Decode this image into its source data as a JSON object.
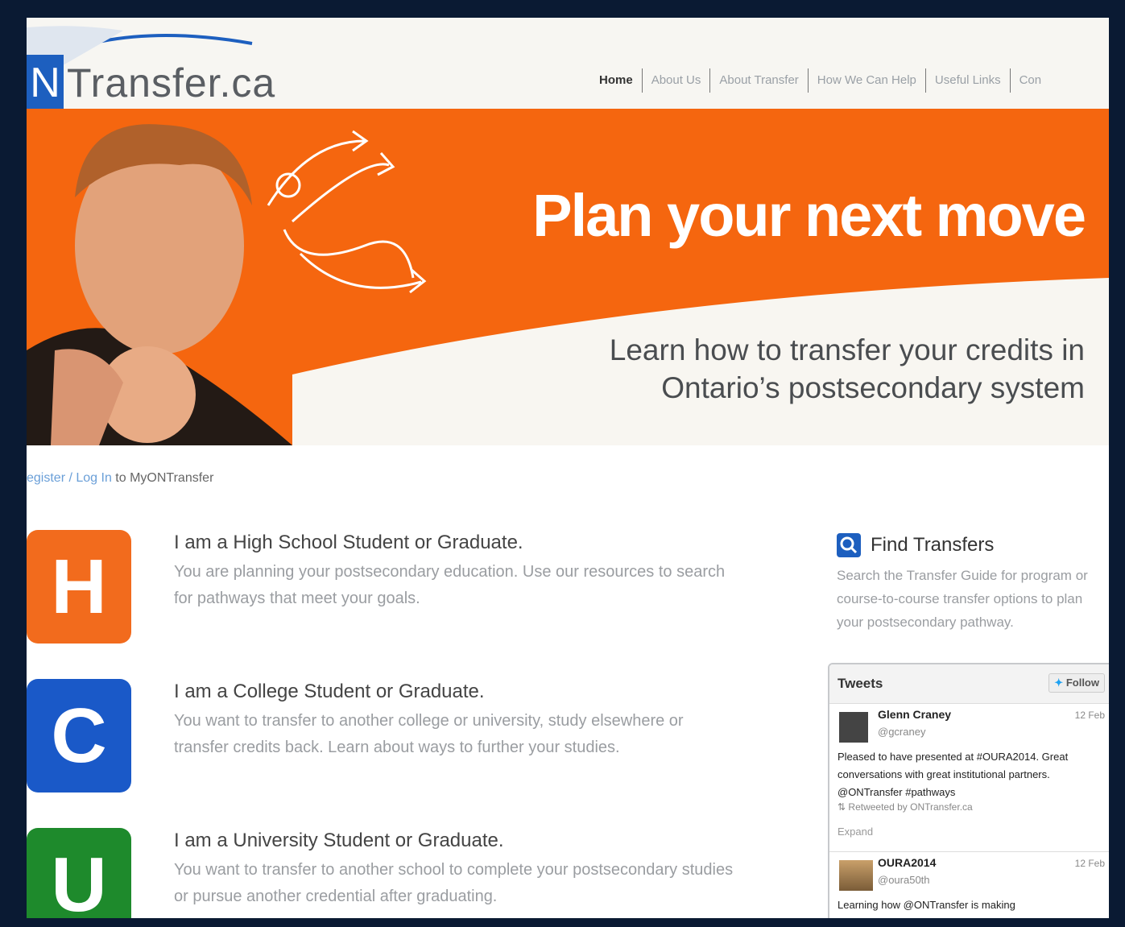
{
  "logo": {
    "letter": "N",
    "text": "Transfer.ca"
  },
  "nav": [
    {
      "label": "Home",
      "active": true
    },
    {
      "label": "About Us"
    },
    {
      "label": "About Transfer"
    },
    {
      "label": "How We Can Help"
    },
    {
      "label": "Useful Links"
    },
    {
      "label": "Con"
    }
  ],
  "hero": {
    "title": "Plan your next move",
    "subtitle": "Learn how to transfer your credits in Ontario’s postsecondary system"
  },
  "login": {
    "register": "egister",
    "sep": " / ",
    "login": "Log In",
    "suffix": " to MyONTransfer"
  },
  "students": [
    {
      "letter": "H",
      "color": "#f26b1d",
      "title": "I am a High School Student or Graduate.",
      "text": "You are planning your postsecondary education. Use our resources to search for pathways that meet your goals."
    },
    {
      "letter": "C",
      "color": "#1a59c8",
      "title": "I am a College Student or Graduate.",
      "text": "You want to transfer to another college or university, study elsewhere or transfer credits back. Learn about ways to further your studies."
    },
    {
      "letter": "U",
      "color": "#1e8a2c",
      "title": "I am a University Student or Graduate.",
      "text": "You want to transfer to another school to complete your postsecondary studies or pursue another credential after graduating."
    }
  ],
  "find": {
    "title": "Find Transfers",
    "text": "Search the Transfer Guide for program or course-to-course transfer options to plan your postsecondary pathway."
  },
  "tweets": {
    "title": "Tweets",
    "follow": "Follow",
    "items": [
      {
        "name": "Glenn Craney",
        "handle": "@gcraney",
        "date": "12 Feb",
        "body": "Pleased to have presented at #OURA2014. Great conversations with great institutional partners. @ONTransfer #pathways",
        "retweet": "Retweeted by ONTransfer.ca",
        "expand": "Expand"
      },
      {
        "name": "OURA2014",
        "handle": "@oura50th",
        "date": "12 Feb",
        "body": "Learning how @ONTransfer is making"
      }
    ]
  }
}
